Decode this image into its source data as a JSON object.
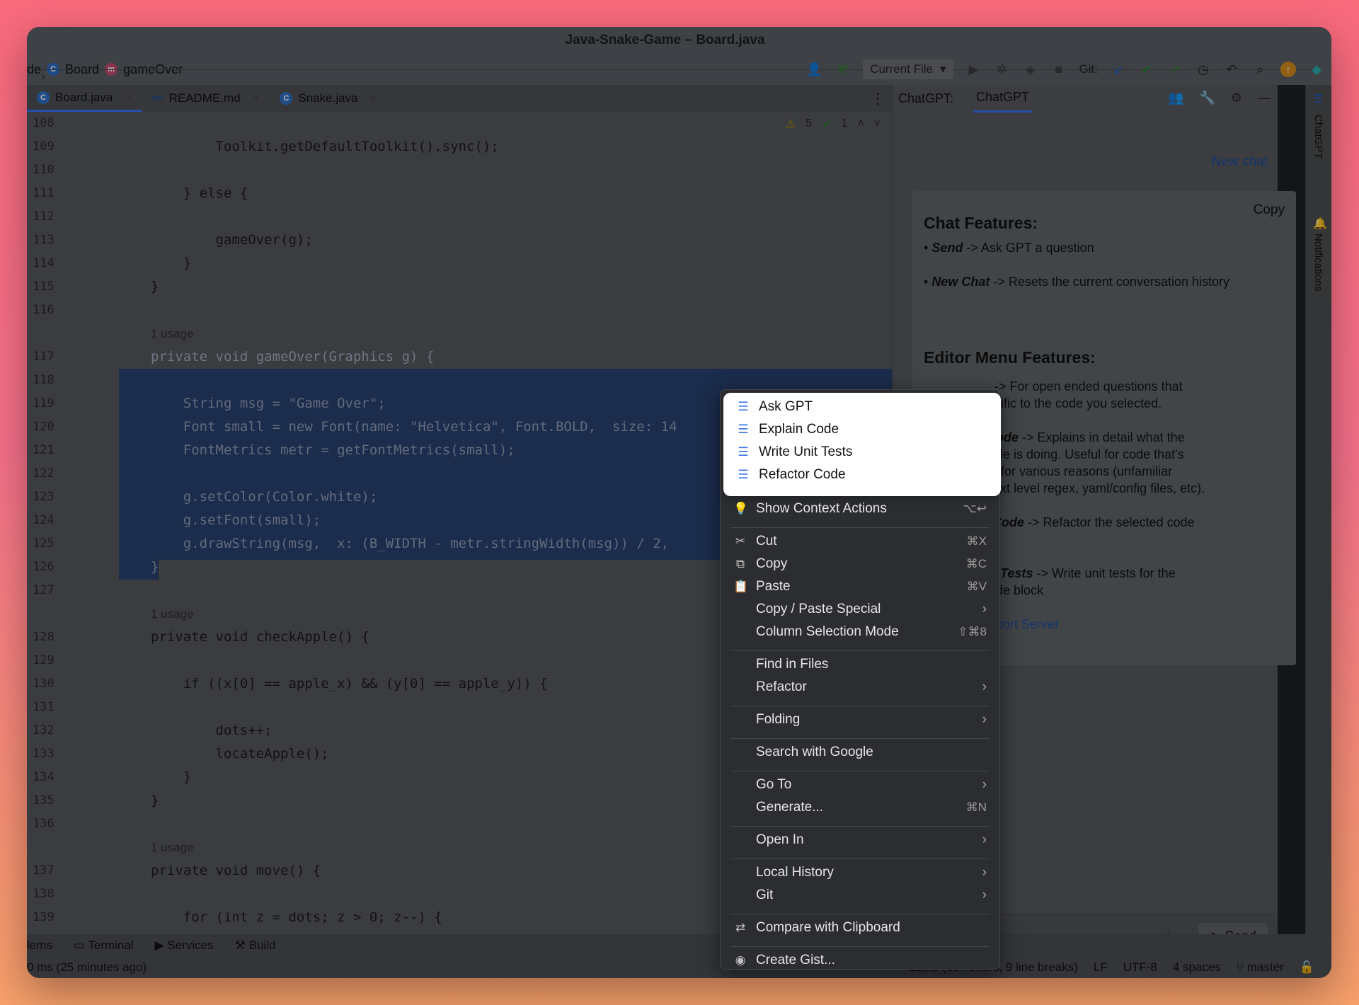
{
  "window": {
    "title": "Java-Snake-Game – Board.java"
  },
  "breadcrumb": {
    "root": "de",
    "class": "Board",
    "method": "gameOver"
  },
  "toolbar": {
    "run_config": "Current File",
    "git_label": "Git:"
  },
  "tabs": [
    {
      "label": "Board.java",
      "icon": "C"
    },
    {
      "label": "README.md",
      "icon": "MD"
    },
    {
      "label": "Snake.java",
      "icon": "C"
    }
  ],
  "inspections": {
    "warnings": "5",
    "checks": "1"
  },
  "code_lines": [
    {
      "n": "108",
      "text": ""
    },
    {
      "n": "109",
      "text": "        Toolkit.getDefaultToolkit().sync();"
    },
    {
      "n": "110",
      "text": ""
    },
    {
      "n": "111",
      "text": "    } else {"
    },
    {
      "n": "112",
      "text": ""
    },
    {
      "n": "113",
      "text": "        gameOver(g);"
    },
    {
      "n": "114",
      "text": "    }"
    },
    {
      "n": "115",
      "text": "}"
    },
    {
      "n": "116",
      "text": ""
    },
    {
      "n": "",
      "text": "1 usage"
    },
    {
      "n": "117",
      "text": "private void gameOver(Graphics g) {"
    },
    {
      "n": "118",
      "text": ""
    },
    {
      "n": "119",
      "text": "    String msg = \"Game Over\";"
    },
    {
      "n": "120",
      "text": "    Font small = new Font(name: \"Helvetica\", Font.BOLD,  size: 14"
    },
    {
      "n": "121",
      "text": "    FontMetrics metr = getFontMetrics(small);"
    },
    {
      "n": "122",
      "text": ""
    },
    {
      "n": "123",
      "text": "    g.setColor(Color.white);"
    },
    {
      "n": "124",
      "text": "    g.setFont(small);"
    },
    {
      "n": "125",
      "text": "    g.drawString(msg,  x: (B_WIDTH - metr.stringWidth(msg)) / 2,"
    },
    {
      "n": "126",
      "text": "}"
    },
    {
      "n": "127",
      "text": ""
    },
    {
      "n": "",
      "text": "1 usage"
    },
    {
      "n": "128",
      "text": "private void checkApple() {"
    },
    {
      "n": "129",
      "text": ""
    },
    {
      "n": "130",
      "text": "    if ((x[0] == apple_x) && (y[0] == apple_y)) {"
    },
    {
      "n": "131",
      "text": ""
    },
    {
      "n": "132",
      "text": "        dots++;"
    },
    {
      "n": "133",
      "text": "        locateApple();"
    },
    {
      "n": "134",
      "text": "    }"
    },
    {
      "n": "135",
      "text": "}"
    },
    {
      "n": "136",
      "text": ""
    },
    {
      "n": "",
      "text": "1 usage"
    },
    {
      "n": "137",
      "text": "private void move() {"
    },
    {
      "n": "138",
      "text": ""
    },
    {
      "n": "139",
      "text": "    for (int z = dots; z > 0; z--) {"
    }
  ],
  "chat": {
    "header_label": "ChatGPT:",
    "tab": "ChatGPT",
    "new_chat": "New chat",
    "copy": "Copy",
    "h1": "Chat Features:",
    "send_item_key": "Send",
    "send_item_desc": "-> Ask GPT a question",
    "newchat_item_key": "New Chat",
    "newchat_item_desc": "-> Resets the current conversation history",
    "h2": "Editor Menu Features:",
    "ask_line": "-> For open ended questions that",
    "ask_line2": "cific to the code you selected.",
    "explain_key": "in Code",
    "explain_line": "-> Explains in detail what the",
    "explain_line2": "d code is doing. Useful for code that's",
    "explain_line3": "read for various reasons (unfamiliar",
    "explain_line4": "e, next level regex, yaml/config files, etc).",
    "refactor_key": "tor Code",
    "refactor_line": "-> Refactor the selected code",
    "tests_key": "Unit Tests",
    "tests_line": "-> Write unit tests for the",
    "tests_line2": "d code block",
    "support": "Support Server",
    "input_placeholder": "ything",
    "send_button": "Send"
  },
  "side_labels": {
    "chatgpt": "ChatGPT",
    "notifications": "Notifications"
  },
  "bottom_tools": [
    "lems",
    "Terminal",
    "Services",
    "Build"
  ],
  "status": {
    "left": "0 ms (25 minutes ago)",
    "position": "118:9 (337 chars, 9 line breaks)",
    "line_sep": "LF",
    "encoding": "UTF-8",
    "indent": "4 spaces",
    "branch": "master"
  },
  "menu": {
    "gpt_items": [
      "Ask GPT",
      "Explain Code",
      "Write Unit Tests",
      "Refactor Code"
    ],
    "items": [
      {
        "label": "Show Context Actions",
        "shortcut": "⌥↩",
        "icon": "bulb-icon"
      },
      {
        "label": "Cut",
        "shortcut": "⌘X",
        "icon": "scissors-icon"
      },
      {
        "label": "Copy",
        "shortcut": "⌘C",
        "icon": "copy-icon"
      },
      {
        "label": "Paste",
        "shortcut": "⌘V",
        "icon": "paste-icon"
      },
      {
        "label": "Copy / Paste Special",
        "shortcut": "",
        "submenu": true
      },
      {
        "label": "Column Selection Mode",
        "shortcut": "⇧⌘8"
      },
      {
        "label": "Find in Files",
        "shortcut": ""
      },
      {
        "label": "Refactor",
        "submenu": true
      },
      {
        "label": "Folding",
        "submenu": true
      },
      {
        "label": "Search with Google"
      },
      {
        "label": "Go To",
        "submenu": true
      },
      {
        "label": "Generate...",
        "shortcut": "⌘N"
      },
      {
        "label": "Open In",
        "submenu": true
      },
      {
        "label": "Local History",
        "submenu": true
      },
      {
        "label": "Git",
        "submenu": true
      },
      {
        "label": "Compare with Clipboard",
        "icon": "compare-icon"
      },
      {
        "label": "Create Gist...",
        "icon": "github-icon"
      }
    ]
  }
}
